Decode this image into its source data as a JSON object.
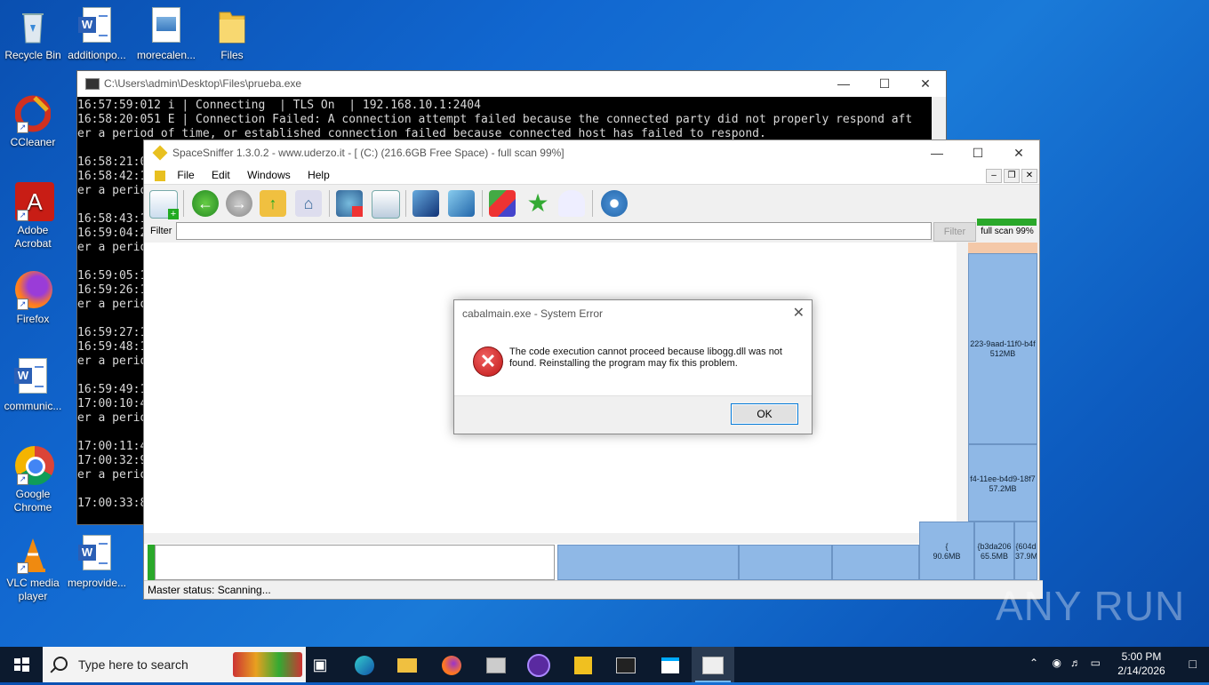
{
  "desktop": {
    "icons": [
      {
        "label": "Recycle Bin"
      },
      {
        "label": "additionpo..."
      },
      {
        "label": "morecalen..."
      },
      {
        "label": "Files"
      },
      {
        "label": "CCleaner"
      },
      {
        "label": "Adobe Acrobat"
      },
      {
        "label": "Firefox"
      },
      {
        "label": "communic..."
      },
      {
        "label": "Google Chrome"
      },
      {
        "label": "VLC media player"
      },
      {
        "label": "meprovide..."
      }
    ]
  },
  "console": {
    "title": "C:\\Users\\admin\\Desktop\\Files\\prueba.exe",
    "text": "16:57:59:012 i | Connecting  | TLS On  | 192.168.10.1:2404\n16:58:20:051 E | Connection Failed: A connection attempt failed because the connected party did not properly respond aft\ner a period of time, or established connection failed because connected host has failed to respond.\n\n16:58:21:0\n16:58:42:1\ner a perio\n\n16:58:43:1\n16:59:04:2\ner a perio\n\n16:59:05:1\n16:59:26:1\ner a perio\n\n16:59:27:1\n16:59:48:1\ner a perio\n\n16:59:49:1\n17:00:10:4\ner a perio\n\n17:00:11:4\n17:00:32:9\ner a perio\n\n17:00:33:8"
  },
  "spacesniffer": {
    "title": "SpaceSniffer 1.3.0.2 - www.uderzo.it - [ (C:) (216.6GB Free Space) - full scan 99%]",
    "menu": [
      "File",
      "Edit",
      "Windows",
      "Help"
    ],
    "filter_label": "Filter",
    "filter_value": "",
    "filter_button": "Filter",
    "progress_label": "full scan 99%",
    "progress": 0.99,
    "status": "Master status: Scanning...",
    "tiles": [
      {
        "line1": "223-9aad-11f0-b4f",
        "line2": "512MB"
      },
      {
        "line1": "f4-11ee-b4d9-18f7",
        "line2": "57.2MB"
      },
      {
        "line1": "{",
        "line2": "90.6MB"
      },
      {
        "line1": "{b3da206",
        "line2": "65.5MB"
      },
      {
        "line1": "{604d",
        "line2": "37.9M"
      }
    ]
  },
  "dialog": {
    "title": "cabalmain.exe - System Error",
    "message": "The code execution cannot proceed because libogg.dll was not found. Reinstalling the program may fix this problem.",
    "ok_label": "OK"
  },
  "taskbar": {
    "search_placeholder": "Type here to search",
    "time": "5:00 PM",
    "date": "2/14/2026"
  },
  "watermark": "ANY RUN"
}
